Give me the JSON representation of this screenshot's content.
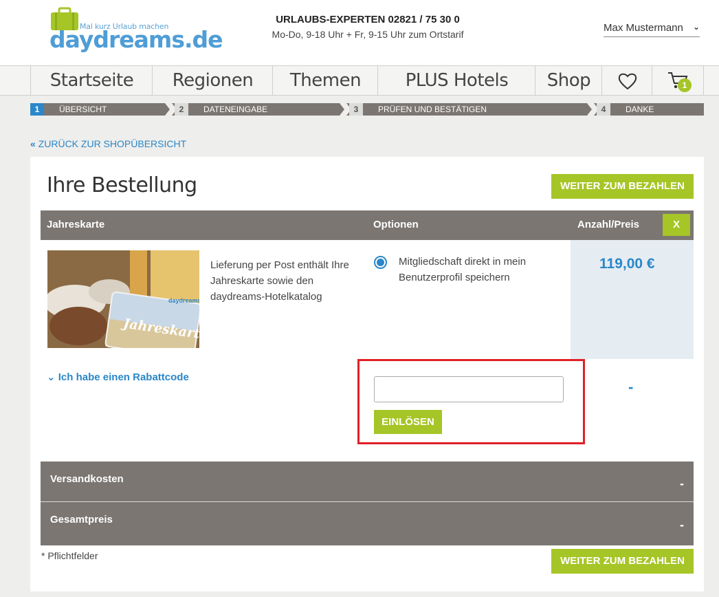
{
  "header": {
    "logo_tagline": "Mal kurz Urlaub machen",
    "logo_brand": "daydreams.de",
    "contact_title": "URLAUBS-EXPERTEN 02821 / 75 30 0",
    "contact_hours": "Mo-Do, 9-18 Uhr + Fr, 9-15 Uhr zum Ortstarif",
    "user_name": "Max Mustermann"
  },
  "nav": {
    "items": [
      "Startseite",
      "Regionen",
      "Themen",
      "PLUS Hotels",
      "Shop"
    ],
    "cart_count": "1"
  },
  "steps": [
    {
      "num": "1",
      "label": "ÜBERSICHT"
    },
    {
      "num": "2",
      "label": "DATENEINGABE"
    },
    {
      "num": "3",
      "label": "PRÜFEN UND BESTÄTIGEN"
    },
    {
      "num": "4",
      "label": "DANKE"
    }
  ],
  "back_link": "ZURÜCK ZUR SHOPÜBERSICHT",
  "order": {
    "title": "Ihre Bestellung",
    "pay_button": "WEITER ZUM BEZAHLEN",
    "columns": [
      "Jahreskarte",
      "Optionen",
      "Anzahl/Preis"
    ],
    "remove_button": "X",
    "card_image_label": "Jahreskarte",
    "card_image_brand": "daydreams.de",
    "description": "Lieferung per Post enthält Ihre Jahreskarte sowie den daydreams-Hotelkatalog",
    "option_text": "Mitgliedschaft direkt in mein Benutzerprofil speichern",
    "price": "119,00  €",
    "rabatt_toggle": "Ich habe einen Rabattcode",
    "redeem_button": "EINLÖSEN",
    "rabatt_value": "-",
    "shipping_label": "Versandkosten",
    "shipping_value": "-",
    "total_label": "Gesamtpreis",
    "total_value": "-",
    "required_note": "* Pflichtfelder"
  },
  "colors": {
    "accent_green": "#a6c526",
    "accent_blue": "#2a87c9",
    "table_gray": "#7b7672",
    "highlight_red": "#e01f26"
  }
}
